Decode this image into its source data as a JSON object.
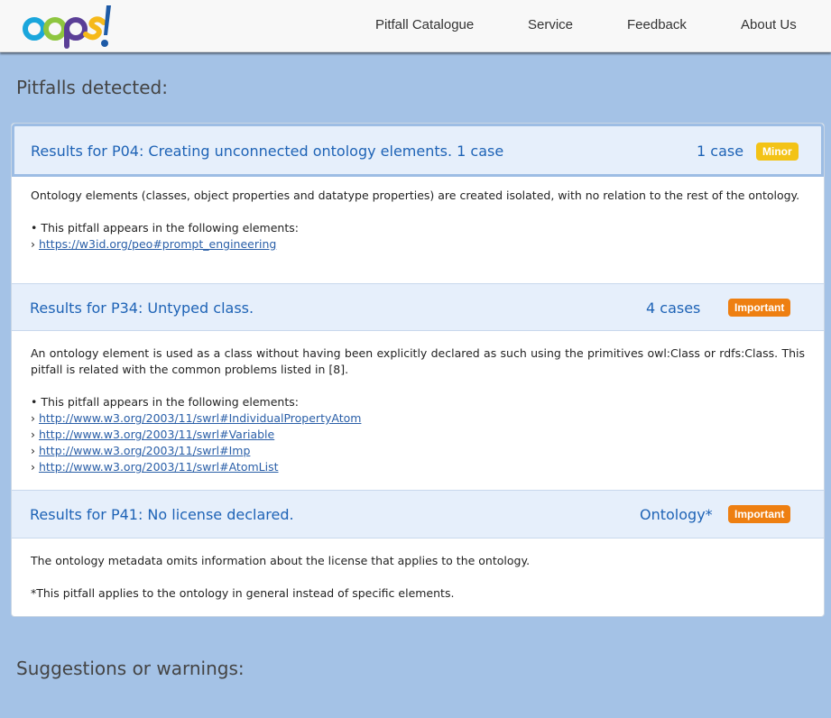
{
  "header": {
    "logo_text": "oops!",
    "nav": [
      "Pitfall Catalogue",
      "Service",
      "Feedback",
      "About Us"
    ]
  },
  "pitfalls_heading": "Pitfalls detected:",
  "suggestions_heading": "Suggestions or warnings:",
  "results": [
    {
      "title": "Results for P04: Creating unconnected ontology elements. 1 case",
      "count": "1 case",
      "badge": "Minor",
      "description": "Ontology elements (classes, object properties and datatype properties) are created isolated, with no relation to the rest of the ontology.",
      "elements_intro": "• This pitfall appears in the following elements:",
      "elements": [
        "https://w3id.org/peo#prompt_engineering"
      ]
    },
    {
      "title": "Results for P34: Untyped class.",
      "count": "4 cases",
      "badge": "Important",
      "description": "An ontology element is used as a class without having been explicitly declared as such using the primitives owl:Class or rdfs:Class. This pitfall is related with the common problems listed in [8].",
      "elements_intro": "• This pitfall appears in the following elements:",
      "elements": [
        "http://www.w3.org/2003/11/swrl#IndividualPropertyAtom",
        "http://www.w3.org/2003/11/swrl#Variable",
        "http://www.w3.org/2003/11/swrl#Imp",
        "http://www.w3.org/2003/11/swrl#AtomList"
      ]
    },
    {
      "title": "Results for P41: No license declared.",
      "count": "Ontology*",
      "badge": "Important",
      "description": "The ontology metadata omits information about the license that applies to the ontology.",
      "note": "*This pitfall applies to the ontology in general instead of specific elements."
    }
  ],
  "colors": {
    "page_bg": "#a4c2e6",
    "header_bg": "#f8f8f8",
    "result_title": "#1e63b6",
    "badge_minor": "#f3c316",
    "badge_important": "#ee7f11",
    "link": "#2a5fa8"
  }
}
